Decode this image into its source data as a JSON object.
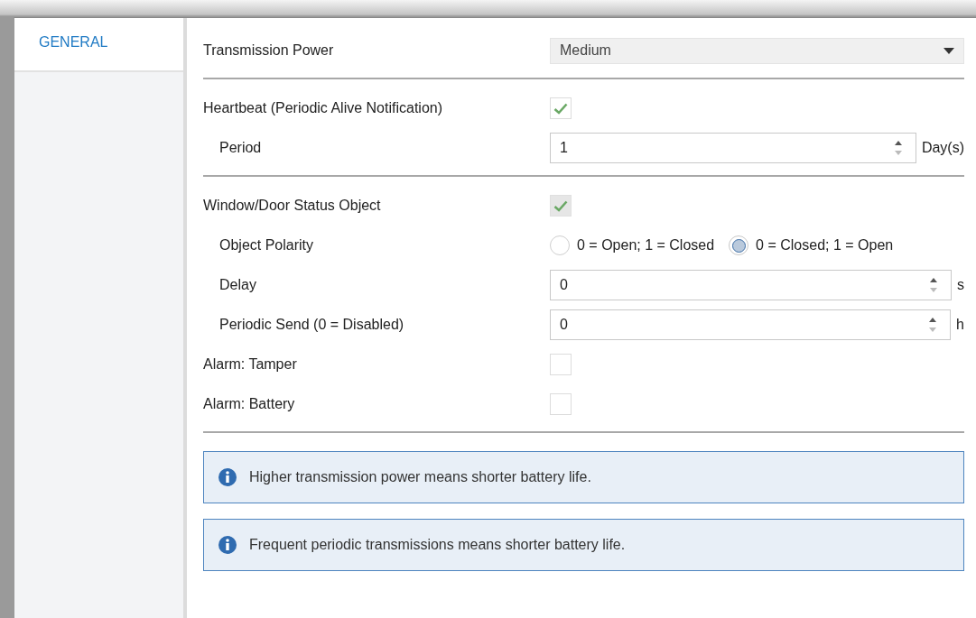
{
  "sidebar": {
    "tabs": [
      {
        "label": "GENERAL",
        "selected": true
      }
    ]
  },
  "sections": [
    {
      "rows": [
        {
          "kind": "dropdown",
          "label": "Transmission Power",
          "value": "Medium"
        }
      ]
    },
    {
      "rows": [
        {
          "kind": "checkbox",
          "label": "Heartbeat (Periodic Alive Notification)",
          "checked": true,
          "disabled": false,
          "children": [
            {
              "kind": "spinner",
              "label": "Period",
              "value": "1",
              "unit": "Day(s)"
            }
          ]
        }
      ]
    },
    {
      "rows": [
        {
          "kind": "checkbox",
          "label": "Window/Door Status Object",
          "checked": true,
          "disabled": true,
          "children": [
            {
              "kind": "radio",
              "label": "Object Polarity",
              "options": [
                {
                  "label": "0 = Open; 1 = Closed",
                  "selected": false
                },
                {
                  "label": "0 = Closed; 1 = Open",
                  "selected": true
                }
              ]
            },
            {
              "kind": "spinner",
              "label": "Delay",
              "value": "0",
              "unit": "s"
            },
            {
              "kind": "spinner",
              "label": "Periodic Send (0 = Disabled)",
              "value": "0",
              "unit": "h"
            }
          ]
        },
        {
          "kind": "checkbox",
          "label": "Alarm: Tamper",
          "checked": false,
          "disabled": false
        },
        {
          "kind": "checkbox",
          "label": "Alarm: Battery",
          "checked": false,
          "disabled": false
        }
      ]
    }
  ],
  "notes": [
    {
      "text": "Higher transmission power means shorter battery life."
    },
    {
      "text": "Frequent periodic transmissions means shorter battery life."
    }
  ]
}
